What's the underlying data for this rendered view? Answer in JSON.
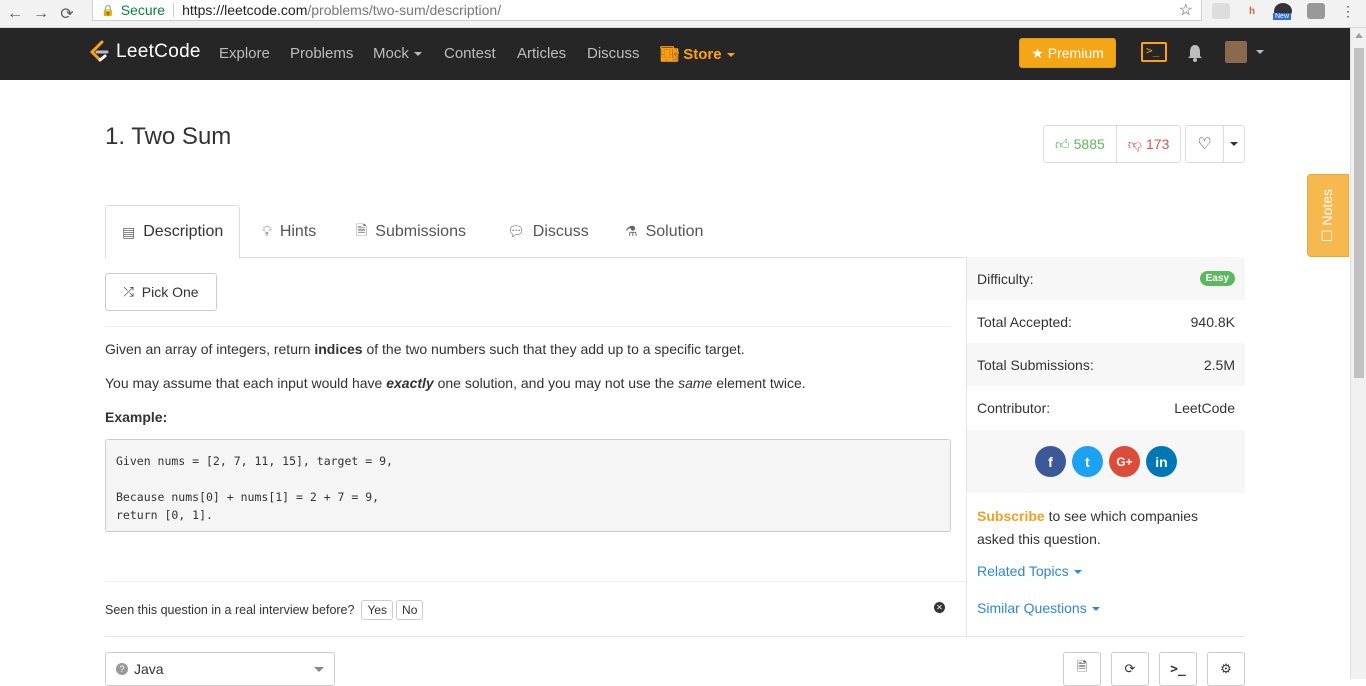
{
  "browser": {
    "secure_label": "Secure",
    "url_host": "https://leetcode.com",
    "url_path": "/problems/two-sum/description/",
    "ext_new_badge": "New"
  },
  "navbar": {
    "brand": "LeetCode",
    "links": [
      "Explore",
      "Problems",
      "Mock",
      "Contest",
      "Articles",
      "Discuss"
    ],
    "store": "Store",
    "premium": "Premium",
    "accent_color": "#ffa116"
  },
  "problem": {
    "title": "1. Two Sum",
    "upvotes": "5885",
    "downvotes": "173"
  },
  "tabs": [
    "Description",
    "Hints",
    "Submissions",
    "Discuss",
    "Solution"
  ],
  "content": {
    "pick_one": "Pick One",
    "para1_a": "Given an array of integers, return ",
    "para1_b": "indices",
    "para1_c": " of the two numbers such that they add up to a specific target.",
    "para2_a": "You may assume that each input would have ",
    "para2_b": "exactly",
    "para2_c": " one solution, and you may not use the ",
    "para2_d": "same",
    "para2_e": " element twice.",
    "example_label": "Example:",
    "code": "Given nums = [2, 7, 11, 15], target = 9,\n\nBecause nums[0] + nums[1] = 2 + 7 = 9,\nreturn [0, 1].",
    "interview_q": "Seen this question in a real interview before?",
    "yes": "Yes",
    "no": "No",
    "language": "Java"
  },
  "sidebar": {
    "difficulty_label": "Difficulty:",
    "difficulty": "Easy",
    "accepted_label": "Total Accepted:",
    "accepted": "940.8K",
    "submissions_label": "Total Submissions:",
    "submissions": "2.5M",
    "contributor_label": "Contributor:",
    "contributor": "LeetCode",
    "subscribe_link": "Subscribe",
    "subscribe_text": " to see which companies asked this question.",
    "related_topics": "Related Topics",
    "similar_questions": "Similar Questions"
  },
  "notes": "Notes"
}
